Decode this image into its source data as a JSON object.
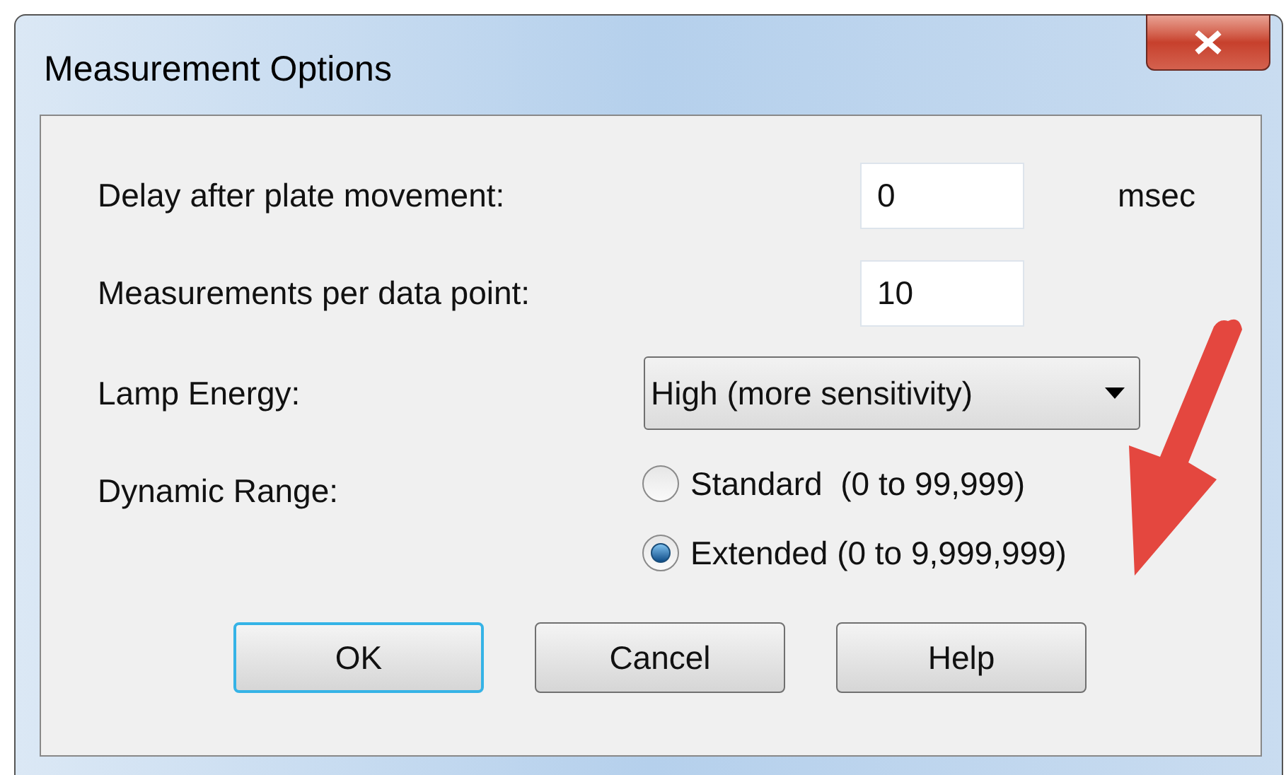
{
  "window": {
    "title": "Measurement Options"
  },
  "fields": [
    {
      "label": "Delay after plate movement:",
      "value": "0",
      "unit": "msec"
    },
    {
      "label": "Measurements per data point:",
      "value": "10"
    }
  ],
  "lamp_energy": {
    "label": "Lamp Energy:",
    "value": "High (more sensitivity)"
  },
  "dynamic_range": {
    "label": "Dynamic Range:",
    "options": [
      {
        "label": "Standard  (0 to 99,999)",
        "selected": false
      },
      {
        "label": "Extended (0 to 9,999,999)",
        "selected": true
      }
    ]
  },
  "buttons": [
    {
      "label": "OK",
      "default": true
    },
    {
      "label": "Cancel",
      "default": false
    },
    {
      "label": "Help",
      "default": false
    }
  ]
}
